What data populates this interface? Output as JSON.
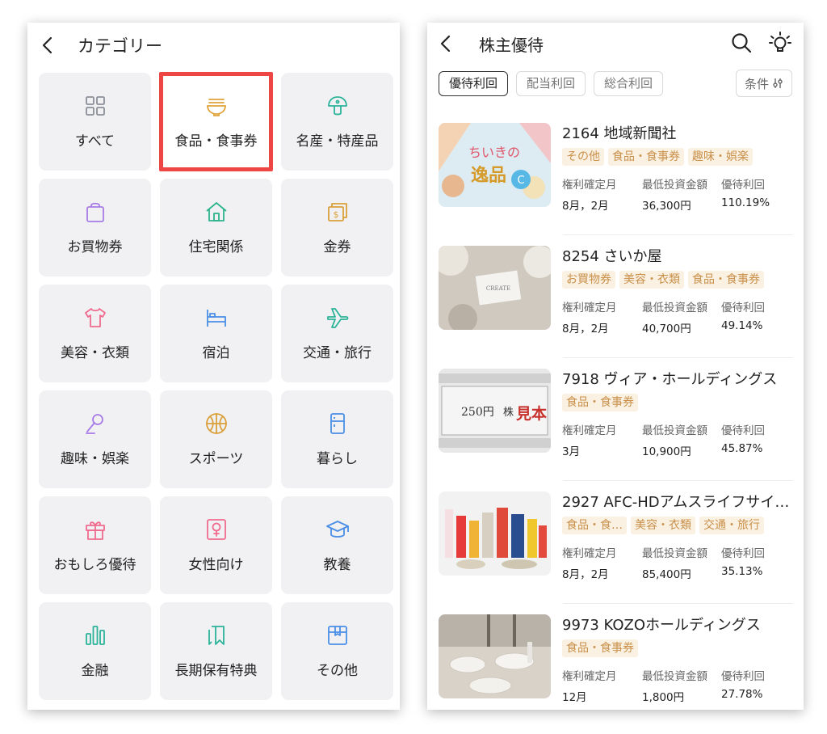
{
  "left": {
    "header": {
      "title": "カテゴリー",
      "back_icon": "chevron-left-icon"
    },
    "categories": [
      {
        "label": "すべて",
        "icon": "grid-icon",
        "color": "#8a8f98"
      },
      {
        "label": "食品・食事券",
        "icon": "bowl-icon",
        "color": "#e0a43c",
        "selected": true
      },
      {
        "label": "名産・特産品",
        "icon": "mushroom-icon",
        "color": "#2bb39a"
      },
      {
        "label": "お買物券",
        "icon": "shopping-bag-icon",
        "color": "#a77be6"
      },
      {
        "label": "住宅関係",
        "icon": "house-icon",
        "color": "#2bb38a"
      },
      {
        "label": "金券",
        "icon": "money-icon",
        "color": "#d9a03a"
      },
      {
        "label": "美容・衣類",
        "icon": "shirt-icon",
        "color": "#f06b8f"
      },
      {
        "label": "宿泊",
        "icon": "bed-icon",
        "color": "#4a8ee6"
      },
      {
        "label": "交通・旅行",
        "icon": "airplane-icon",
        "color": "#2bb39a"
      },
      {
        "label": "趣味・娯楽",
        "icon": "microphone-icon",
        "color": "#a77be6"
      },
      {
        "label": "スポーツ",
        "icon": "ball-icon",
        "color": "#d9a03a"
      },
      {
        "label": "暮らし",
        "icon": "fridge-icon",
        "color": "#4a8ee6"
      },
      {
        "label": "おもしろ優待",
        "icon": "gift-icon",
        "color": "#f06b8f"
      },
      {
        "label": "女性向け",
        "icon": "female-icon",
        "color": "#f06b8f"
      },
      {
        "label": "教養",
        "icon": "graduation-cap-icon",
        "color": "#4a8ee6"
      },
      {
        "label": "金融",
        "icon": "bar-chart-icon",
        "color": "#2bb39a"
      },
      {
        "label": "長期保有特典",
        "icon": "bookmark-icon",
        "color": "#2bb39a"
      },
      {
        "label": "その他",
        "icon": "box-icon",
        "color": "#4a8ee6"
      }
    ]
  },
  "right": {
    "header": {
      "title": "株主優待",
      "back_icon": "chevron-left-icon",
      "search_icon": "search-icon",
      "hint_icon": "lightbulb-icon"
    },
    "tabs": [
      {
        "label": "優待利回",
        "active": true
      },
      {
        "label": "配当利回",
        "active": false
      },
      {
        "label": "総合利回",
        "active": false
      }
    ],
    "condition_button": {
      "label": "条件",
      "icon": "sliders-icon"
    },
    "column_labels": {
      "record_month": "権利確定月",
      "min_investment": "最低投資金額",
      "yield": "優待利回"
    },
    "items": [
      {
        "name": "2164 地域新聞社",
        "tags": [
          "その他",
          "食品・食事券",
          "趣味・娯楽"
        ],
        "record_month": "8月，2月",
        "min_investment": "36,300円",
        "yield": "110.19%",
        "thumb_texts": [
          "ちいきの",
          "逸品"
        ]
      },
      {
        "name": "8254 さいか屋",
        "tags": [
          "お買物券",
          "美容・衣類",
          "食品・食事券"
        ],
        "record_month": "8月，2月",
        "min_investment": "40,700円",
        "yield": "49.14%",
        "thumb_texts": [
          "CREATE"
        ]
      },
      {
        "name": "7918 ヴィア・ホールディングス",
        "tags": [
          "食品・食事券"
        ],
        "record_month": "3月",
        "min_investment": "10,900円",
        "yield": "45.87%",
        "thumb_texts": [
          "250円",
          "株",
          "見本"
        ]
      },
      {
        "name": "2927 AFC-HDアムスライフサイ…",
        "tags": [
          "食品・食…",
          "美容・衣類",
          "交通・旅行"
        ],
        "record_month": "8月，2月",
        "min_investment": "85,400円",
        "yield": "35.13%",
        "thumb_texts": []
      },
      {
        "name": "9973 KOZOホールディングス",
        "tags": [
          "食品・食事券"
        ],
        "record_month": "12月",
        "min_investment": "1,800円",
        "yield": "27.78%",
        "thumb_texts": []
      }
    ]
  },
  "colors": {
    "highlight": "#ee4545",
    "tag_bg": "#fbf1e2",
    "tag_text": "#c9904a",
    "tile_bg": "#f1f1f3"
  }
}
